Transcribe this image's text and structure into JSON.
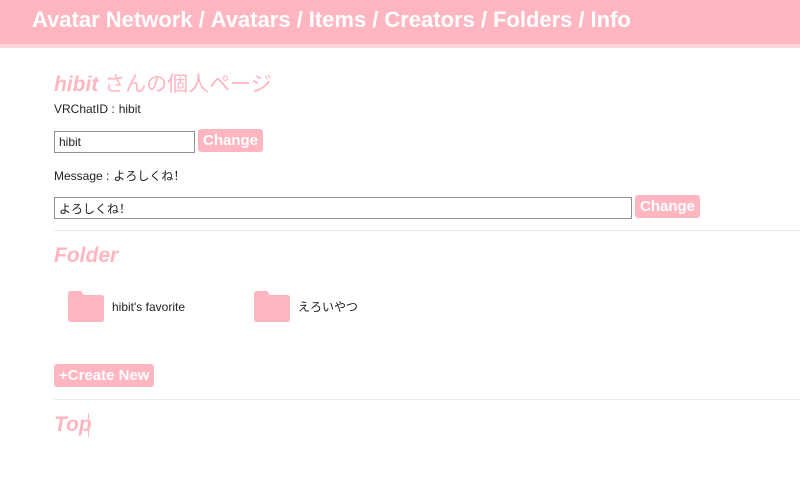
{
  "nav": {
    "items": [
      "Avatar Network",
      "Avatars",
      "Items",
      "Creators",
      "Folders",
      "Info"
    ],
    "separator": "/"
  },
  "profile": {
    "username": "hibit",
    "title_suffix": " さんの個人ページ",
    "vrchat_id_label": "VRChatID :",
    "vrchat_id_value": "hibit",
    "id_input_value": "hibit",
    "change_label": "Change",
    "message_label": "Message :",
    "message_value": "よろしくね！",
    "message_input_value": "よろしくね！"
  },
  "folders": {
    "heading": "Folder",
    "items": [
      {
        "name": "hibit's favorite",
        "icon": "folder-icon"
      },
      {
        "name": "えろいやつ",
        "icon": "folder-icon"
      }
    ],
    "create_label": "+Create New"
  },
  "top": {
    "label": "Top"
  },
  "colors": {
    "accent": "#ffb6c1",
    "header_border": "#ffd3da",
    "divider": "#ebebeb"
  }
}
